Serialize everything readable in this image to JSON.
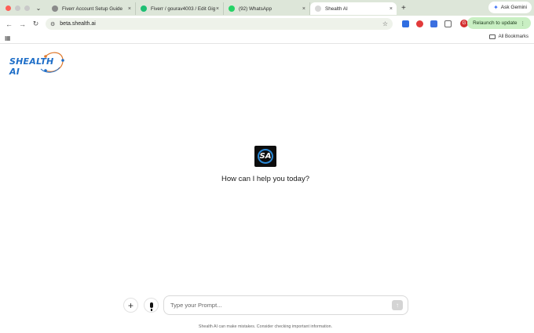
{
  "browser": {
    "tabs": [
      {
        "title": "Fiverr Account Setup Guide",
        "favicon_color": "#8a8a8a",
        "active": false
      },
      {
        "title": "Fiverr / gourav4003 / Edit Gig",
        "favicon_color": "#1dbf73",
        "active": false
      },
      {
        "title": "(92) WhatsApp",
        "favicon_color": "#25d366",
        "active": false
      },
      {
        "title": "Shealth AI",
        "favicon_color": "#d8d8d8",
        "active": true
      }
    ],
    "close_glyph": "×",
    "new_tab_glyph": "+",
    "ask_gemini": "Ask Gemini",
    "url": "beta.shealth.ai",
    "relaunch": "Relaunch to update",
    "profile_initial": "G",
    "all_bookmarks": "All Bookmarks",
    "extension_colors": [
      "#2f6de1",
      "#e23b3b",
      "#3b6fe0",
      "#666666"
    ]
  },
  "page": {
    "logo_text": "SHEALTH AI",
    "center_logo_text": "SA",
    "prompt_title": "How can I help you today?",
    "input_placeholder": "Type your Prompt...",
    "input_value": "",
    "plus_glyph": "+",
    "disclaimer": "Shealth AI can make mistakes. Consider checking important information."
  },
  "colors": {
    "brand_blue": "#1e6ec8",
    "accent_orange": "#e07a2e",
    "relaunch_bg": "#c9efc3"
  }
}
